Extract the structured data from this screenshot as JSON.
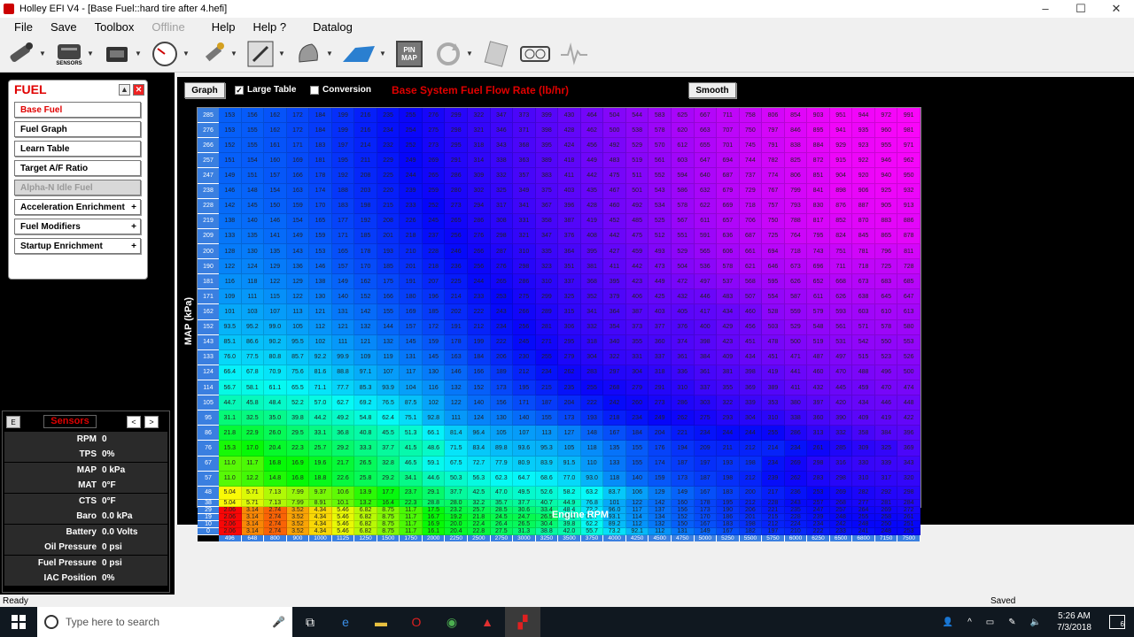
{
  "window": {
    "title": "Holley EFI V4 - [Base Fuel::hard tire after 4.hefi]",
    "min": "–",
    "max": "☐",
    "close": "✕"
  },
  "menu": {
    "file": "File",
    "save": "Save",
    "toolbox": "Toolbox",
    "offline": "Offline",
    "help": "Help",
    "help2": "Help ?",
    "datalog": "Datalog"
  },
  "toolbar": {
    "sensors_label": "SENSORS",
    "pinmap": "PIN MAP"
  },
  "fuel_panel": {
    "title": "FUEL",
    "items": [
      {
        "label": "Base Fuel",
        "plus": ""
      },
      {
        "label": "Fuel Graph",
        "plus": ""
      },
      {
        "label": "Learn Table",
        "plus": ""
      },
      {
        "label": "Target A/F Ratio",
        "plus": ""
      },
      {
        "label": "Alpha-N Idle Fuel",
        "plus": ""
      },
      {
        "label": "Acceleration Enrichment",
        "plus": "+"
      },
      {
        "label": "Fuel Modifiers",
        "plus": "+"
      },
      {
        "label": "Startup Enrichment",
        "plus": "+"
      }
    ]
  },
  "sensors": {
    "title": "Sensors",
    "e_btn": "E",
    "prev": "<",
    "next": ">",
    "rows": [
      {
        "name": "RPM",
        "value": "0"
      },
      {
        "name": "TPS",
        "value": "0%"
      },
      {
        "name": "MAP",
        "value": "0 kPa"
      },
      {
        "name": "MAT",
        "value": "0°F"
      },
      {
        "name": "CTS",
        "value": "0°F"
      },
      {
        "name": "Baro",
        "value": "0.0 kPa"
      },
      {
        "name": "Battery",
        "value": "0.0 Volts"
      },
      {
        "name": "Oil Pressure",
        "value": "0 psi"
      },
      {
        "name": "Fuel Pressure",
        "value": "0 psi"
      },
      {
        "name": "IAC Position",
        "value": "0%"
      }
    ]
  },
  "table": {
    "graph_btn": "Graph",
    "large_table": "Large Table",
    "large_checked": "✓",
    "conversion": "Conversion",
    "title": "Base System Fuel Flow Rate (lb/hr)",
    "smooth_btn": "Smooth",
    "y_label": "MAP (kPa)",
    "x_label": "Engine RPM",
    "rpm": [
      "496",
      "648",
      "800",
      "900",
      "1000",
      "1125",
      "1250",
      "1500",
      "1750",
      "2000",
      "2250",
      "2500",
      "2750",
      "3000",
      "3250",
      "3500",
      "3750",
      "4000",
      "4250",
      "4500",
      "4750",
      "5000",
      "5250",
      "5500",
      "5750",
      "6000",
      "6250",
      "6500",
      "6800",
      "7150",
      "7500"
    ],
    "map": [
      "285",
      "276",
      "266",
      "257",
      "247",
      "238",
      "228",
      "219",
      "209",
      "200",
      "190",
      "181",
      "171",
      "162",
      "152",
      "143",
      "133",
      "124",
      "114",
      "105",
      "95",
      "86",
      "76",
      "67",
      "57",
      "48",
      "38",
      "29",
      "19",
      "10",
      "0"
    ],
    "rows": [
      [
        "153",
        "156",
        "162",
        "172",
        "184",
        "199",
        "216",
        "235",
        "255",
        "276",
        "299",
        "322",
        "347",
        "373",
        "399",
        "430",
        "464",
        "504",
        "544",
        "583",
        "625",
        "667",
        "711",
        "758",
        "806",
        "854",
        "903",
        "951",
        "944",
        "972",
        "991"
      ],
      [
        "153",
        "155",
        "162",
        "172",
        "184",
        "199",
        "216",
        "234",
        "254",
        "275",
        "298",
        "321",
        "346",
        "371",
        "398",
        "428",
        "462",
        "500",
        "538",
        "578",
        "620",
        "663",
        "707",
        "750",
        "797",
        "846",
        "895",
        "941",
        "935",
        "960",
        "981"
      ],
      [
        "152",
        "155",
        "161",
        "171",
        "183",
        "197",
        "214",
        "232",
        "252",
        "273",
        "295",
        "318",
        "343",
        "368",
        "395",
        "424",
        "456",
        "492",
        "529",
        "570",
        "612",
        "655",
        "701",
        "745",
        "791",
        "838",
        "884",
        "929",
        "923",
        "955",
        "971"
      ],
      [
        "151",
        "154",
        "160",
        "169",
        "181",
        "195",
        "211",
        "229",
        "249",
        "269",
        "291",
        "314",
        "338",
        "363",
        "389",
        "418",
        "449",
        "483",
        "519",
        "561",
        "603",
        "647",
        "694",
        "744",
        "782",
        "825",
        "872",
        "915",
        "922",
        "946",
        "962"
      ],
      [
        "149",
        "151",
        "157",
        "166",
        "178",
        "192",
        "208",
        "225",
        "244",
        "265",
        "286",
        "309",
        "332",
        "357",
        "383",
        "411",
        "442",
        "475",
        "511",
        "552",
        "594",
        "640",
        "687",
        "737",
        "774",
        "806",
        "851",
        "904",
        "920",
        "940",
        "950"
      ],
      [
        "146",
        "148",
        "154",
        "163",
        "174",
        "188",
        "203",
        "220",
        "239",
        "259",
        "280",
        "302",
        "325",
        "349",
        "375",
        "403",
        "435",
        "467",
        "501",
        "543",
        "586",
        "632",
        "679",
        "729",
        "767",
        "799",
        "841",
        "898",
        "906",
        "925",
        "932"
      ],
      [
        "142",
        "145",
        "150",
        "159",
        "170",
        "183",
        "198",
        "215",
        "233",
        "252",
        "273",
        "294",
        "317",
        "341",
        "367",
        "396",
        "428",
        "460",
        "492",
        "534",
        "578",
        "622",
        "669",
        "718",
        "757",
        "793",
        "830",
        "876",
        "887",
        "905",
        "913"
      ],
      [
        "138",
        "140",
        "146",
        "154",
        "165",
        "177",
        "192",
        "208",
        "226",
        "245",
        "265",
        "286",
        "308",
        "331",
        "358",
        "387",
        "419",
        "452",
        "485",
        "525",
        "567",
        "611",
        "657",
        "706",
        "750",
        "788",
        "817",
        "852",
        "870",
        "883",
        "886"
      ],
      [
        "133",
        "135",
        "141",
        "149",
        "159",
        "171",
        "185",
        "201",
        "218",
        "237",
        "256",
        "276",
        "298",
        "321",
        "347",
        "376",
        "408",
        "442",
        "475",
        "512",
        "551",
        "591",
        "636",
        "687",
        "725",
        "764",
        "795",
        "824",
        "845",
        "865",
        "878"
      ],
      [
        "128",
        "130",
        "135",
        "143",
        "153",
        "165",
        "178",
        "193",
        "210",
        "228",
        "246",
        "266",
        "287",
        "310",
        "335",
        "364",
        "395",
        "427",
        "459",
        "493",
        "529",
        "565",
        "606",
        "661",
        "694",
        "718",
        "743",
        "751",
        "781",
        "796",
        "811"
      ],
      [
        "122",
        "124",
        "129",
        "136",
        "146",
        "157",
        "170",
        "185",
        "201",
        "218",
        "236",
        "256",
        "276",
        "298",
        "323",
        "351",
        "381",
        "411",
        "442",
        "473",
        "504",
        "536",
        "578",
        "621",
        "646",
        "673",
        "696",
        "711",
        "718",
        "725",
        "728"
      ],
      [
        "116",
        "118",
        "122",
        "129",
        "138",
        "149",
        "162",
        "175",
        "191",
        "207",
        "225",
        "244",
        "265",
        "286",
        "310",
        "337",
        "368",
        "395",
        "423",
        "449",
        "472",
        "497",
        "537",
        "568",
        "595",
        "626",
        "652",
        "668",
        "673",
        "683",
        "685"
      ],
      [
        "109",
        "111",
        "115",
        "122",
        "130",
        "140",
        "152",
        "166",
        "180",
        "196",
        "214",
        "233",
        "253",
        "275",
        "299",
        "325",
        "352",
        "379",
        "406",
        "425",
        "432",
        "446",
        "483",
        "507",
        "554",
        "587",
        "611",
        "626",
        "638",
        "645",
        "647"
      ],
      [
        "101",
        "103",
        "107",
        "113",
        "121",
        "131",
        "142",
        "155",
        "169",
        "185",
        "202",
        "222",
        "243",
        "266",
        "289",
        "315",
        "341",
        "364",
        "387",
        "403",
        "405",
        "417",
        "434",
        "460",
        "528",
        "559",
        "579",
        "593",
        "603",
        "610",
        "613"
      ],
      [
        "93.5",
        "95.2",
        "99.0",
        "105",
        "112",
        "121",
        "132",
        "144",
        "157",
        "172",
        "191",
        "212",
        "234",
        "256",
        "281",
        "306",
        "332",
        "354",
        "373",
        "377",
        "376",
        "400",
        "429",
        "456",
        "503",
        "529",
        "548",
        "561",
        "571",
        "578",
        "580"
      ],
      [
        "85.1",
        "86.6",
        "90.2",
        "95.5",
        "102",
        "111",
        "121",
        "132",
        "145",
        "159",
        "178",
        "199",
        "222",
        "245",
        "271",
        "295",
        "318",
        "340",
        "355",
        "360",
        "374",
        "398",
        "423",
        "451",
        "478",
        "500",
        "519",
        "531",
        "542",
        "550",
        "553"
      ],
      [
        "76.0",
        "77.5",
        "80.8",
        "85.7",
        "92.2",
        "99.9",
        "109",
        "119",
        "131",
        "145",
        "163",
        "184",
        "206",
        "230",
        "255",
        "279",
        "304",
        "322",
        "331",
        "337",
        "361",
        "384",
        "409",
        "434",
        "451",
        "471",
        "487",
        "497",
        "515",
        "523",
        "526"
      ],
      [
        "66.4",
        "67.8",
        "70.9",
        "75.6",
        "81.6",
        "88.8",
        "97.1",
        "107",
        "117",
        "130",
        "146",
        "166",
        "189",
        "212",
        "234",
        "262",
        "283",
        "297",
        "304",
        "318",
        "336",
        "361",
        "381",
        "398",
        "419",
        "441",
        "460",
        "470",
        "488",
        "496",
        "500"
      ],
      [
        "56.7",
        "58.1",
        "61.1",
        "65.5",
        "71.1",
        "77.7",
        "85.3",
        "93.9",
        "104",
        "116",
        "132",
        "152",
        "173",
        "195",
        "215",
        "235",
        "255",
        "268",
        "279",
        "291",
        "310",
        "337",
        "355",
        "369",
        "389",
        "411",
        "432",
        "445",
        "459",
        "470",
        "474"
      ],
      [
        "44.7",
        "45.8",
        "48.4",
        "52.2",
        "57.0",
        "62.7",
        "69.2",
        "76.5",
        "87.5",
        "102",
        "122",
        "140",
        "156",
        "171",
        "187",
        "204",
        "222",
        "242",
        "260",
        "273",
        "286",
        "303",
        "322",
        "339",
        "353",
        "380",
        "397",
        "420",
        "434",
        "446",
        "448"
      ],
      [
        "31.1",
        "32.5",
        "35.0",
        "39.8",
        "44.2",
        "49.2",
        "54.8",
        "62.4",
        "75.1",
        "92.8",
        "111",
        "124",
        "130",
        "140",
        "155",
        "173",
        "193",
        "218",
        "234",
        "249",
        "262",
        "275",
        "293",
        "304",
        "310",
        "338",
        "360",
        "390",
        "409",
        "419",
        "422"
      ],
      [
        "21.8",
        "22.9",
        "26.0",
        "29.5",
        "33.1",
        "36.8",
        "40.8",
        "45.5",
        "51.3",
        "66.1",
        "81.4",
        "96.4",
        "105",
        "107",
        "113",
        "127",
        "148",
        "167",
        "184",
        "204",
        "221",
        "234",
        "244",
        "244",
        "255",
        "286",
        "313",
        "332",
        "358",
        "384",
        "396"
      ],
      [
        "15.3",
        "17.0",
        "20.4",
        "22.3",
        "25.7",
        "29.2",
        "33.3",
        "37.7",
        "41.5",
        "48.6",
        "71.5",
        "83.4",
        "89.8",
        "93.6",
        "95.3",
        "105",
        "118",
        "135",
        "155",
        "176",
        "194",
        "209",
        "211",
        "212",
        "214",
        "234",
        "261",
        "285",
        "309",
        "325",
        "369"
      ],
      [
        "11.0",
        "11.7",
        "16.8",
        "16.9",
        "19.6",
        "21.7",
        "26.5",
        "32.8",
        "46.5",
        "59.1",
        "67.5",
        "72.7",
        "77.9",
        "80.9",
        "83.9",
        "91.5",
        "110",
        "133",
        "155",
        "174",
        "187",
        "197",
        "193",
        "198",
        "234",
        "269",
        "298",
        "316",
        "330",
        "339",
        "343"
      ],
      [
        "11.0",
        "12.2",
        "14.8",
        "16.8",
        "18.8",
        "22.6",
        "25.8",
        "29.2",
        "34.1",
        "44.6",
        "50.3",
        "56.3",
        "62.3",
        "64.7",
        "68.6",
        "77.0",
        "93.0",
        "118",
        "140",
        "159",
        "173",
        "187",
        "198",
        "212",
        "239",
        "262",
        "283",
        "298",
        "310",
        "317",
        "320"
      ],
      [
        "5.04",
        "5.71",
        "7.13",
        "7.99",
        "9.37",
        "10.6",
        "13.9",
        "17.7",
        "23.7",
        "29.1",
        "37.7",
        "42.5",
        "47.0",
        "49.5",
        "52.6",
        "58.2",
        "63.2",
        "83.7",
        "106",
        "129",
        "149",
        "167",
        "183",
        "200",
        "217",
        "236",
        "253",
        "269",
        "282",
        "292",
        "298"
      ],
      [
        "5.04",
        "5.71",
        "7.13",
        "7.99",
        "8.91",
        "10.1",
        "13.2",
        "16.4",
        "22.3",
        "28.8",
        "28.0",
        "32.2",
        "35.7",
        "37.7",
        "40.7",
        "44.9",
        "76.8",
        "101",
        "122",
        "142",
        "160",
        "178",
        "195",
        "212",
        "228",
        "243",
        "257",
        "268",
        "277",
        "281",
        "284"
      ],
      [
        "2.06",
        "3.14",
        "2.74",
        "3.52",
        "4.34",
        "5.46",
        "6.82",
        "8.75",
        "11.7",
        "17.5",
        "23.2",
        "25.7",
        "28.5",
        "30.6",
        "33.4",
        "48.4",
        "72.2",
        "96.0",
        "117",
        "137",
        "156",
        "173",
        "190",
        "206",
        "221",
        "235",
        "247",
        "257",
        "264",
        "269",
        "272"
      ],
      [
        "2.06",
        "3.14",
        "2.74",
        "3.52",
        "4.34",
        "5.46",
        "6.82",
        "8.75",
        "11.7",
        "16.7",
        "19.2",
        "21.8",
        "24.5",
        "24.7",
        "26.5",
        "45.1",
        "65.7",
        "93.1",
        "114",
        "134",
        "152",
        "170",
        "186",
        "201",
        "215",
        "228",
        "239",
        "248",
        "255",
        "258",
        "261"
      ],
      [
        "2.06",
        "3.14",
        "2.74",
        "3.52",
        "4.34",
        "5.46",
        "6.82",
        "8.75",
        "11.7",
        "16.9",
        "20.0",
        "22.4",
        "26.4",
        "26.5",
        "30.4",
        "39.8",
        "62.2",
        "89.2",
        "112",
        "132",
        "150",
        "167",
        "183",
        "198",
        "212",
        "224",
        "234",
        "242",
        "248",
        "250",
        "251"
      ],
      [
        "2.06",
        "3.14",
        "2.74",
        "3.52",
        "4.34",
        "5.46",
        "6.82",
        "8.75",
        "11.7",
        "16.1",
        "20.4",
        "22.8",
        "27.5",
        "31.3",
        "38.8",
        "42.0",
        "55.7",
        "73.2",
        "92.1",
        "112",
        "131",
        "149",
        "167",
        "182",
        "197",
        "210",
        "222",
        "233",
        "241",
        "248",
        "253"
      ]
    ]
  },
  "status": {
    "left": "Ready",
    "right": "Saved"
  },
  "taskbar": {
    "search_placeholder": "Type here to search",
    "time": "5:26 AM",
    "date": "7/3/2018",
    "notif": "6"
  }
}
